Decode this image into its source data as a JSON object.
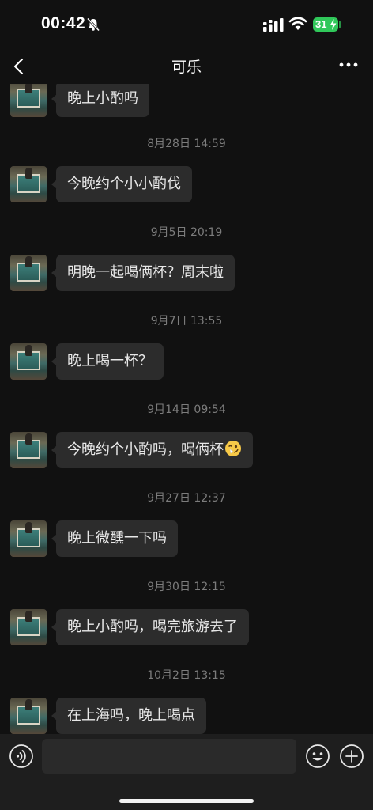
{
  "status_bar": {
    "time": "00:42",
    "battery": "31"
  },
  "header": {
    "title": "可乐"
  },
  "messages": [
    {
      "text": "晚上小酌吗"
    },
    {
      "timestamp": "8月28日 14:59",
      "text": "今晚约个小小酌伐"
    },
    {
      "timestamp": "9月5日 20:19",
      "text": "明晚一起喝俩杯？周末啦"
    },
    {
      "timestamp": "9月7日 13:55",
      "text": "晚上喝一杯？"
    },
    {
      "timestamp": "9月14日 09:54",
      "text": "今晚约个小酌吗，喝俩杯",
      "emoji": "winking-face-emoji"
    },
    {
      "timestamp": "9月27日 12:37",
      "text": "晚上微醺一下吗"
    },
    {
      "timestamp": "9月30日 12:15",
      "text": "晚上小酌吗，喝完旅游去了"
    },
    {
      "timestamp": "10月2日 13:15",
      "text": "在上海吗，晚上喝点"
    }
  ],
  "input_bar": {
    "value": "",
    "icons": [
      "voice-icon",
      "emoji-icon",
      "plus-icon"
    ]
  },
  "colors": {
    "background": "#111111",
    "bubble": "#2c2c2c",
    "timestamp": "#7c7c7c",
    "battery": "#30c85a"
  }
}
